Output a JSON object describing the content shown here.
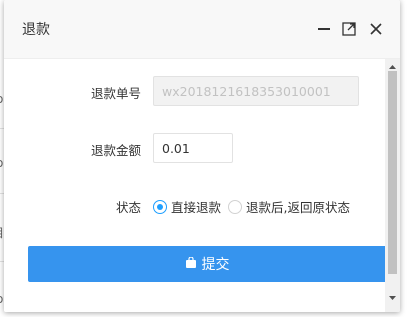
{
  "background": {
    "fragments": [
      "o",
      "o",
      "目",
      "o"
    ]
  },
  "dialog": {
    "title": "退款",
    "icons": {
      "minimize": "minimize-icon",
      "maximize": "maximize-icon",
      "close": "close-icon"
    }
  },
  "form": {
    "refund_no": {
      "label": "退款单号",
      "value": "wx2018121618353010001",
      "disabled": true
    },
    "refund_amount": {
      "label": "退款金额",
      "value": "0.01"
    },
    "status": {
      "label": "状态",
      "options": [
        {
          "label": "直接退款",
          "checked": true
        },
        {
          "label": "退款后,返回原状态",
          "checked": false
        }
      ]
    },
    "submit_label": "提交"
  },
  "colors": {
    "accent": "#1e9fff",
    "button": "#3694ee",
    "titlebar": "#f8f8f8"
  }
}
